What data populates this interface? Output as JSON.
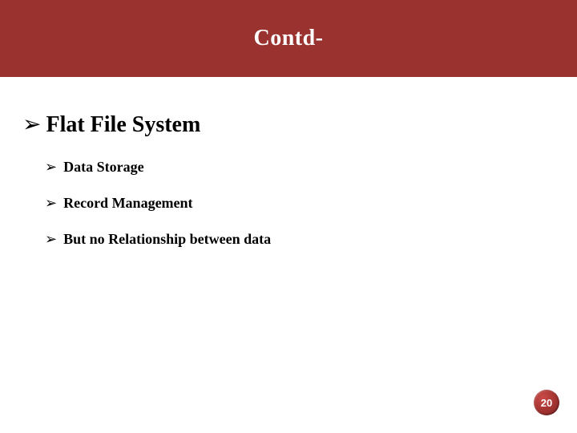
{
  "title": "Contd-",
  "main": {
    "bullet": "➢",
    "label": "Flat File System",
    "items": [
      {
        "bullet": "➢",
        "label": "Data Storage"
      },
      {
        "bullet": "➢",
        "label": "Record Management"
      },
      {
        "bullet": "➢",
        "label": "But no Relationship between data"
      }
    ]
  },
  "page_number": "20",
  "colors": {
    "accent": "#9a3230",
    "badge": "#a23330",
    "text": "#000000",
    "title_text": "#ffffff"
  }
}
